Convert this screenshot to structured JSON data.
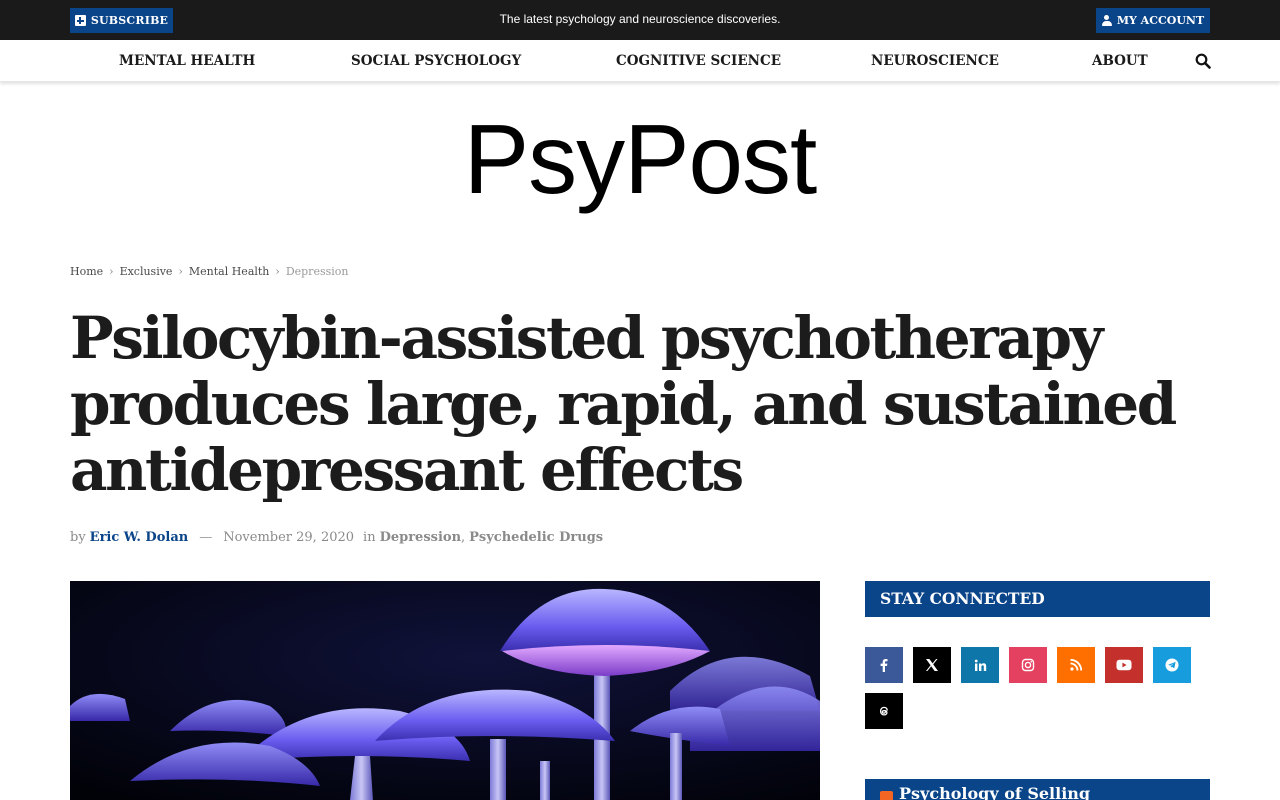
{
  "topbar": {
    "subscribe_label": "SUBSCRIBE",
    "tagline": "The latest psychology and neuroscience discoveries.",
    "account_label": "MY ACCOUNT"
  },
  "nav": {
    "items": [
      {
        "label": "MENTAL HEALTH"
      },
      {
        "label": "SOCIAL PSYCHOLOGY"
      },
      {
        "label": "COGNITIVE SCIENCE"
      },
      {
        "label": "NEUROSCIENCE"
      },
      {
        "label": "ABOUT"
      }
    ],
    "search_icon": "search-icon"
  },
  "logo": "PsyPost",
  "breadcrumb": [
    "Home",
    "Exclusive",
    "Mental Health",
    "Depression"
  ],
  "article": {
    "headline": "Psilocybin-assisted psychotherapy produces large, rapid, and sustained antidepressant effects",
    "by": "by",
    "author": "Eric W. Dolan",
    "dash": "—",
    "date": "November 29, 2020",
    "in": "in",
    "categories": [
      "Depression",
      "Psychedelic Drugs"
    ],
    "category_separator": ","
  },
  "sidebar": {
    "stay_connected": "STAY CONNECTED",
    "socials": [
      {
        "icon": "facebook-icon",
        "color": "#3b5998"
      },
      {
        "icon": "x-icon",
        "color": "#000000"
      },
      {
        "icon": "linkedin-icon",
        "color": "#0e76a8"
      },
      {
        "icon": "instagram-icon",
        "color": "#e4405f"
      },
      {
        "icon": "rss-icon",
        "color": "#ff6f00"
      },
      {
        "icon": "youtube-icon",
        "color": "#c4302b"
      },
      {
        "icon": "telegram-icon",
        "color": "#179cde"
      },
      {
        "icon": "threads-icon",
        "color": "#000000"
      }
    ],
    "psychology_of_selling": "Psychology of Selling"
  },
  "colors": {
    "brand_blue": "#0a4489",
    "topbar_bg": "#1a1a1a"
  }
}
